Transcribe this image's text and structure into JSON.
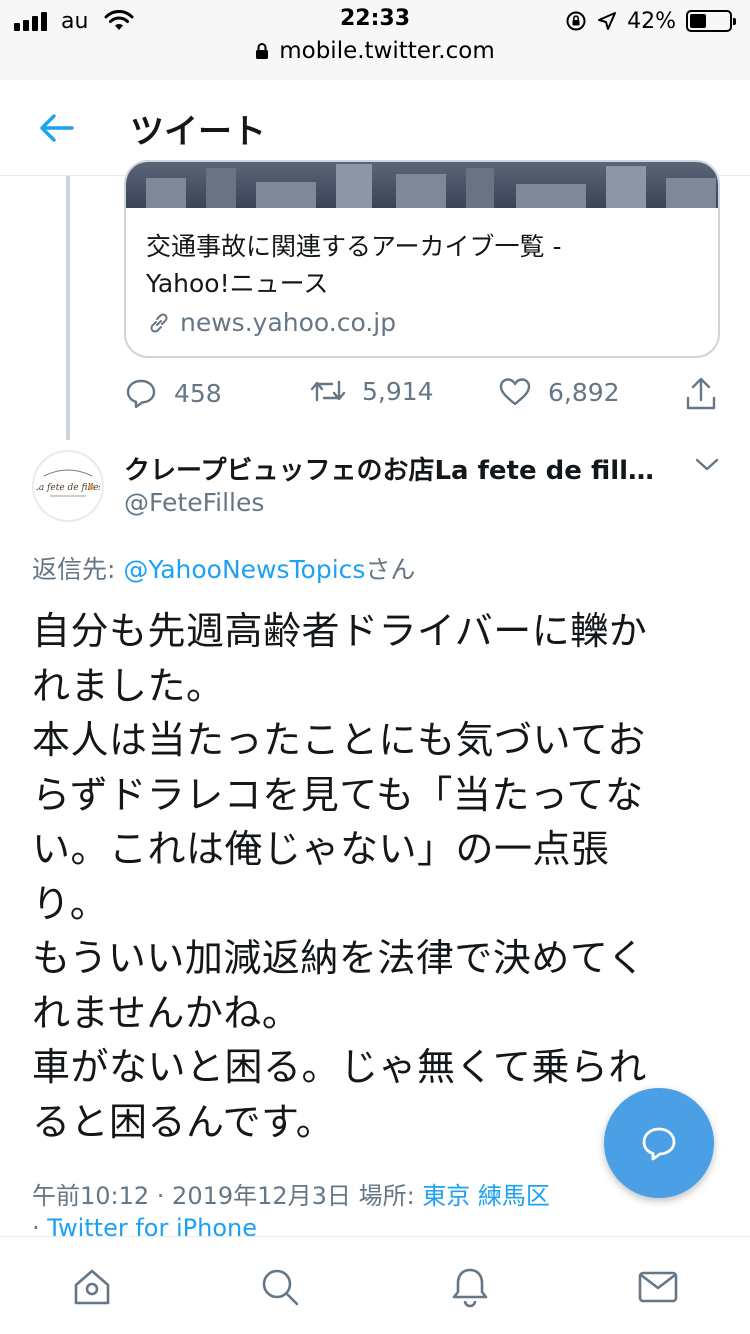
{
  "status_bar": {
    "carrier": "au",
    "time": "22:33",
    "battery_percent": "42%",
    "battery_level": 0.42,
    "url": "mobile.twitter.com",
    "icons": [
      "signal-icon",
      "wifi-icon",
      "orientation-lock-icon",
      "location-icon",
      "battery-icon",
      "lock-icon"
    ]
  },
  "header": {
    "title": "ツイート",
    "back_icon": "arrow-left-icon"
  },
  "parent_tweet": {
    "link_card": {
      "title_line1": "交通事故に関連するアーカイブ一覧 -",
      "title_line2": "Yahoo!ニュース",
      "domain": "news.yahoo.co.jp",
      "domain_icon": "link-icon"
    },
    "actions": {
      "replies": "458",
      "retweets": "5,914",
      "likes": "6,892"
    }
  },
  "tweet": {
    "author_name": "クレープビュッフェのお店La fete de fill…",
    "handle": "@FeteFilles",
    "avatar_text": "La fete de filles",
    "reply_label": "返信先: ",
    "reply_to": "@YahooNewsTopics",
    "reply_suffix": "さん",
    "text_lines": [
      "自分も先週高齢者ドライバーに轢か",
      "れました。",
      "本人は当たったことにも気づいてお",
      "らずドラレコを見ても「当たってな",
      "い。これは俺じゃない」の一点張",
      "り。",
      "もういい加減返納を法律で決めてく",
      "れませんかね。",
      "車がないと困る。じゃ無くて乗られ",
      "ると困るんです。"
    ],
    "time_date": "午前10:12 · 2019年12月3日",
    "location_label": "場所: ",
    "location": "東京 練馬区",
    "source_sep": "·",
    "source": "Twitter for iPhone"
  },
  "fab": {
    "icon": "compose-reply-icon"
  },
  "tabbar": {
    "items": [
      "home-icon",
      "search-icon",
      "notifications-icon",
      "messages-icon"
    ]
  },
  "colors": {
    "accent": "#1da1f2",
    "secondary_text": "#657786",
    "border": "#ccd6dd",
    "fab": "#4a9fe5"
  }
}
